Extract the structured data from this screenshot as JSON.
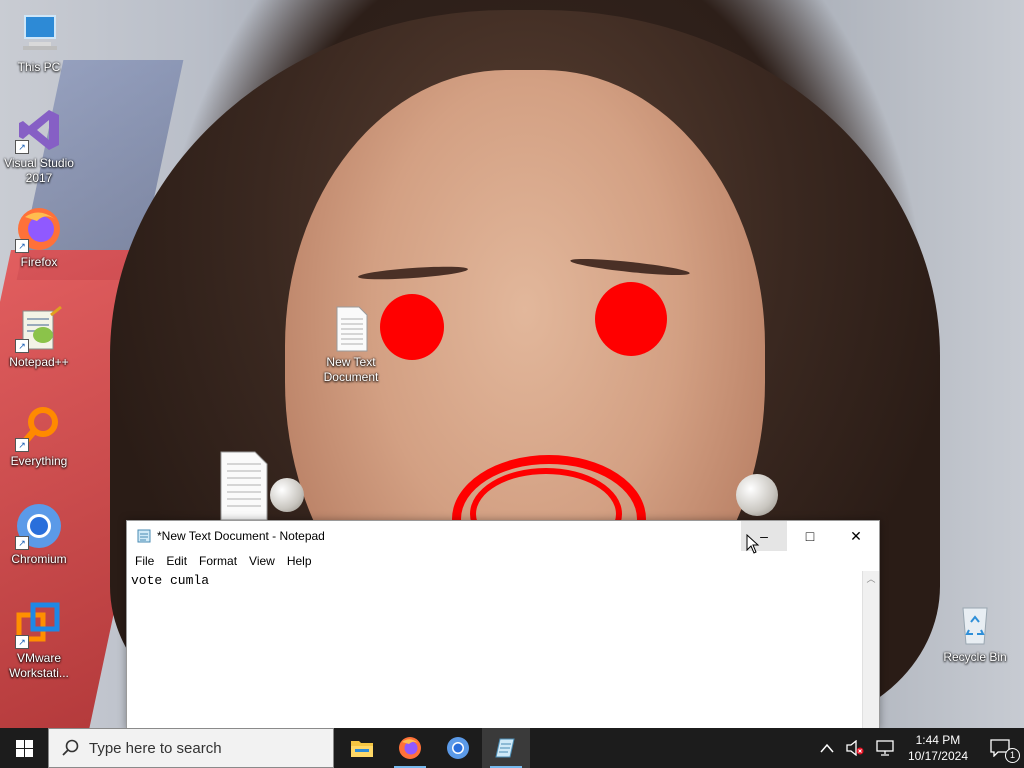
{
  "desktop": {
    "icons": [
      {
        "label_line1": "This PC",
        "label_line2": "",
        "icon": "this-pc-icon"
      },
      {
        "label_line1": "Visual Studio",
        "label_line2": "2017",
        "icon": "visual-studio-icon"
      },
      {
        "label_line1": "Firefox",
        "label_line2": "",
        "icon": "firefox-icon"
      },
      {
        "label_line1": "Notepad++",
        "label_line2": "",
        "icon": "notepad-plus-plus-icon"
      },
      {
        "label_line1": "Everything",
        "label_line2": "",
        "icon": "everything-search-icon"
      },
      {
        "label_line1": "Chromium",
        "label_line2": "",
        "icon": "chromium-icon"
      },
      {
        "label_line1": "VMware",
        "label_line2": "Workstati...",
        "icon": "vmware-icon"
      },
      {
        "label_line1": "New Text",
        "label_line2": "Document",
        "icon": "text-document-icon"
      },
      {
        "label_line1": "Recycle Bin",
        "label_line2": "",
        "icon": "recycle-bin-icon"
      }
    ]
  },
  "notepad": {
    "title": "*New Text Document - Notepad",
    "menu": [
      "File",
      "Edit",
      "Format",
      "View",
      "Help"
    ],
    "content": "vote cumla",
    "controls": {
      "minimize": "–",
      "maximize": "□",
      "close": "✕"
    }
  },
  "taskbar": {
    "search_placeholder": "Type here to search",
    "apps": [
      {
        "name": "File Explorer",
        "icon": "file-explorer-icon",
        "running": false,
        "active": false
      },
      {
        "name": "Firefox",
        "icon": "firefox-icon",
        "running": true,
        "active": false
      },
      {
        "name": "Chromium",
        "icon": "chromium-icon",
        "running": false,
        "active": false
      },
      {
        "name": "Notepad",
        "icon": "notepad-icon",
        "running": true,
        "active": true
      }
    ],
    "clock": {
      "time": "1:44 PM",
      "date": "10/17/2024"
    },
    "notification_count": "1"
  },
  "colors": {
    "accent": "#76b9ed",
    "taskbar": "#1c1c1c",
    "scribble": "#ff0000"
  }
}
